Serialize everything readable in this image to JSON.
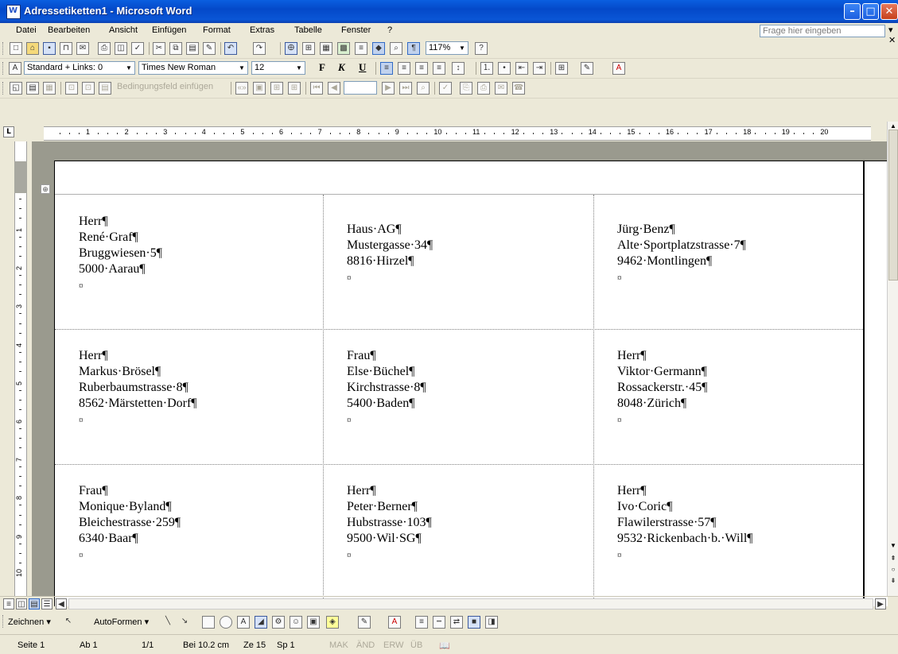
{
  "window": {
    "title": "Adressetiketten1 - Microsoft Word"
  },
  "menu": {
    "items": [
      "Datei",
      "Bearbeiten",
      "Ansicht",
      "Einfügen",
      "Format",
      "Extras",
      "Tabelle",
      "Fenster",
      "?"
    ],
    "help_placeholder": "Frage hier eingeben"
  },
  "toolbar": {
    "zoom": "117%"
  },
  "formatting": {
    "style": "Standard + Links: 0",
    "font": "Times New Roman",
    "size": "12",
    "bold": "F",
    "italic": "K",
    "underline": "U"
  },
  "mailmerge": {
    "insert_field": "Bedingungsfeld einfügen"
  },
  "ruler": {
    "numbers": [
      "1",
      "2",
      "3",
      "4",
      "5",
      "6",
      "7",
      "8",
      "9",
      "10",
      "11",
      "12",
      "13",
      "14",
      "15",
      "16",
      "17",
      "18",
      "19",
      "20"
    ]
  },
  "vruler": {
    "numbers": [
      "1",
      "2",
      "3",
      "4",
      "5",
      "6",
      "7",
      "8",
      "9",
      "10"
    ]
  },
  "labels": [
    [
      "Herr¶",
      "René·Graf¶",
      "Bruggwiesen·5¶",
      "5000·Aarau¶"
    ],
    [
      "Haus·AG¶",
      "Mustergasse·34¶",
      "8816·Hirzel¶"
    ],
    [
      "Jürg·Benz¶",
      "Alte·Sportplatzstrasse·7¶",
      "9462·Montlingen¶"
    ],
    [
      "Herr¶",
      "Markus·Brösel¶",
      "Ruberbaumstrasse·8¶",
      "8562·Märstetten·Dorf¶"
    ],
    [
      "Frau¶",
      "Else·Büchel¶",
      "Kirchstrasse·8¶",
      "5400·Baden¶"
    ],
    [
      "Herr¶",
      "Viktor·Germann¶",
      "Rossackerstr.·45¶",
      "8048·Zürich¶"
    ],
    [
      "Frau¶",
      "Monique·Byland¶",
      "Bleichestrasse·259¶",
      "6340·Baar¶"
    ],
    [
      "Herr¶",
      "Peter·Berner¶",
      "Hubstrasse·103¶",
      "9500·Wil·SG¶"
    ],
    [
      "Herr¶",
      "Ivo·Coric¶",
      "Flawilerstrasse·57¶",
      "9532·Rickenbach·b.·Will¶"
    ]
  ],
  "cell_end_mark": "¤",
  "drawing": {
    "draw": "Zeichnen",
    "autoshapes": "AutoFormen"
  },
  "status": {
    "page": "Seite 1",
    "section": "Ab 1",
    "pages": "1/1",
    "position": "Bei 10.2 cm",
    "line": "Ze 15",
    "column": "Sp 1",
    "modes": [
      "MAK",
      "ÄND",
      "ERW",
      "ÜB"
    ]
  },
  "icons": [
    "word-app-icon",
    "new-icon",
    "open-icon",
    "save-icon",
    "print-icon",
    "spellcheck-icon",
    "undo-icon",
    "redo-icon",
    "table-icon",
    "bold-icon",
    "align-left-icon",
    "bullets-icon",
    "border-icon",
    "highlight-icon",
    "font-color-icon",
    "arrow-icon",
    "line-icon",
    "rectangle-icon",
    "ellipse-icon"
  ]
}
